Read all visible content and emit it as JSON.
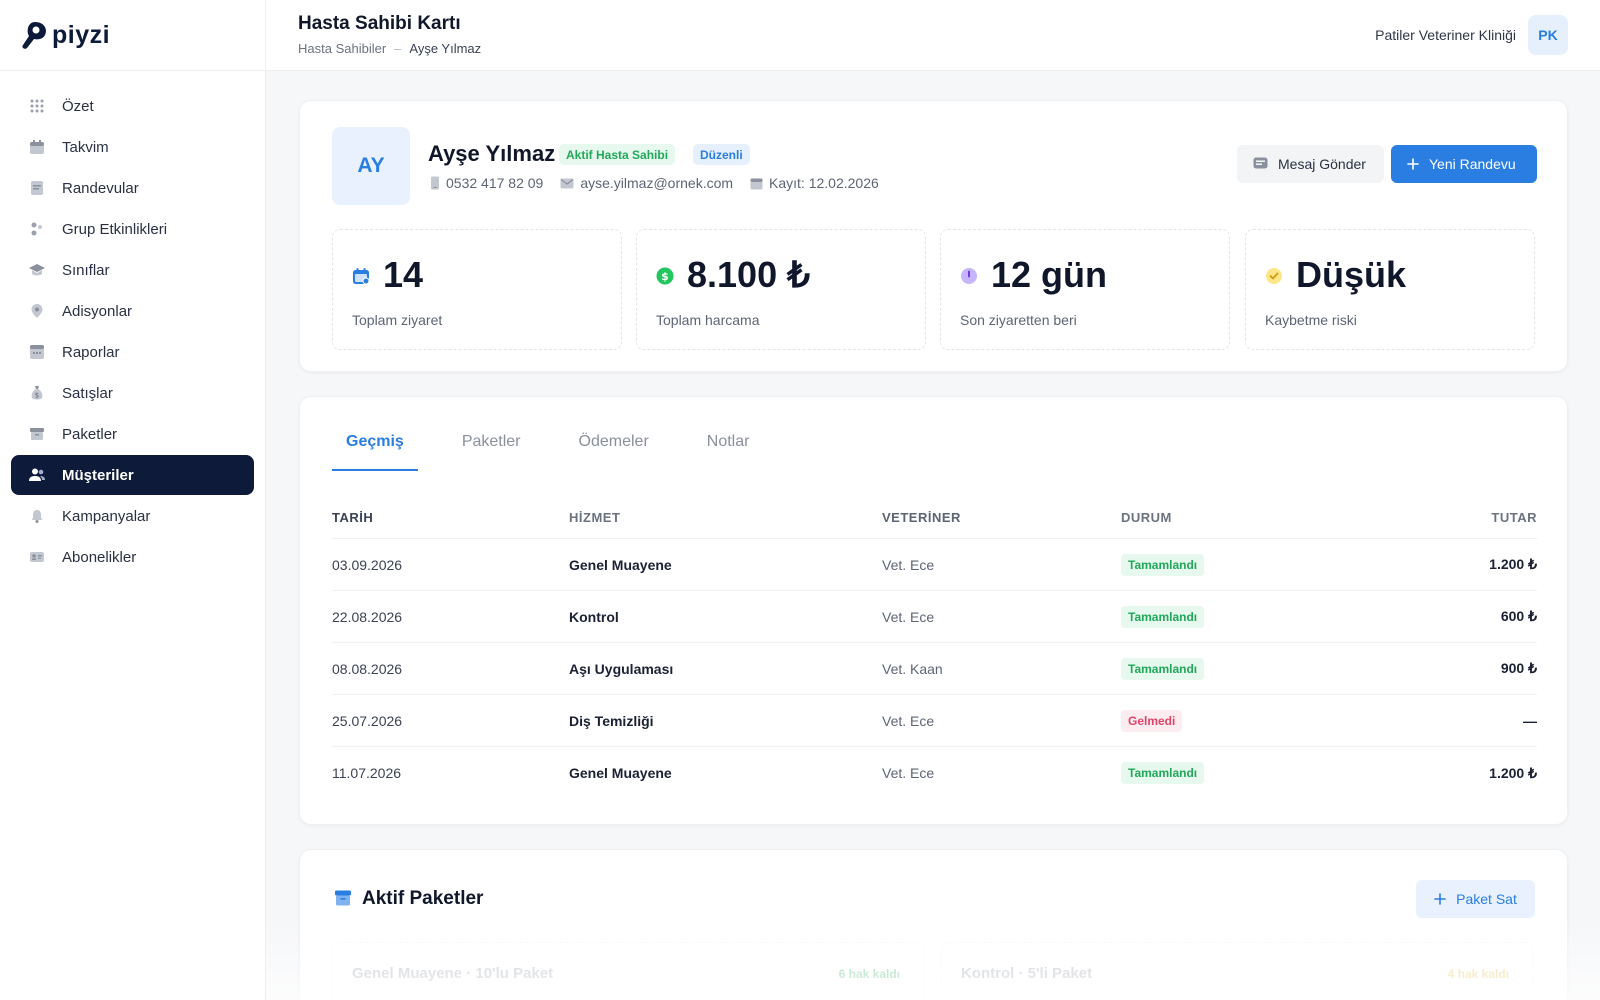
{
  "app": {
    "logo_text": "piyzi"
  },
  "sidebar": {
    "items": [
      {
        "label": "Özet",
        "icon": "grid-icon"
      },
      {
        "label": "Takvim",
        "icon": "calendar-icon"
      },
      {
        "label": "Randevular",
        "icon": "appointment-icon"
      },
      {
        "label": "Grup Etkinlikleri",
        "icon": "group-icon"
      },
      {
        "label": "Sınıflar",
        "icon": "graduation-cap-icon"
      },
      {
        "label": "Adisyonlar",
        "icon": "location-pin-icon"
      },
      {
        "label": "Raporlar",
        "icon": "report-icon"
      },
      {
        "label": "Satışlar",
        "icon": "money-bag-icon"
      },
      {
        "label": "Paketler",
        "icon": "package-icon"
      },
      {
        "label": "Müşteriler",
        "icon": "users-icon",
        "active": true
      },
      {
        "label": "Kampanyalar",
        "icon": "bell-icon"
      },
      {
        "label": "Abonelikler",
        "icon": "id-card-icon"
      }
    ]
  },
  "header": {
    "title": "Hasta Sahibi Kartı",
    "breadcrumb": [
      "Hasta Sahibiler",
      "Ayşe Yılmaz"
    ],
    "breadcrumb_sep": "–",
    "clinic_name": "Patiler Veteriner Kliniği",
    "user_initials": "PK"
  },
  "profile": {
    "initials": "AY",
    "name": "Ayşe Yılmaz",
    "badges": [
      "Aktif Hasta Sahibi",
      "Düzenli"
    ],
    "phone": "0532 417 82 09",
    "email": "ayse.yilmaz@ornek.com",
    "registered": "Kayıt: 12.02.2026",
    "message_button": "Mesaj Gönder",
    "new_appointment_button": "Yeni Randevu"
  },
  "stats": [
    {
      "value": "14",
      "label": "Toplam ziyaret",
      "icon": "calendar-icon",
      "color": "#2a7de1"
    },
    {
      "value": "8.100 ₺",
      "label": "Toplam harcama",
      "icon": "dollar-icon",
      "color": "#22a85a"
    },
    {
      "value": "12 gün",
      "label": "Son ziyaretten beri",
      "icon": "clock-icon",
      "color": "#8b5cf6"
    },
    {
      "value": "Düşük",
      "label": "Kaybetme riski",
      "icon": "shield-check-icon",
      "color": "#f5c542"
    }
  ],
  "tabs": [
    "Geçmiş",
    "Paketler",
    "Ödemeler",
    "Notlar"
  ],
  "history": {
    "columns": [
      "TARİH",
      "HİZMET",
      "VETERİNER",
      "DURUM",
      "TUTAR"
    ],
    "rows": [
      {
        "date": "03.09.2026",
        "service": "Genel Muayene",
        "vet": "Vet. Ece",
        "status": "Tamamlandı",
        "status_type": "ok",
        "amount": "1.200 ₺"
      },
      {
        "date": "22.08.2026",
        "service": "Kontrol",
        "vet": "Vet. Ece",
        "status": "Tamamlandı",
        "status_type": "ok",
        "amount": "600 ₺"
      },
      {
        "date": "08.08.2026",
        "service": "Aşı Uygulaması",
        "vet": "Vet. Kaan",
        "status": "Tamamlandı",
        "status_type": "ok",
        "amount": "900 ₺"
      },
      {
        "date": "25.07.2026",
        "service": "Diş Temizliği",
        "vet": "Vet. Ece",
        "status": "Gelmedi",
        "status_type": "no",
        "amount": "—"
      },
      {
        "date": "11.07.2026",
        "service": "Genel Muayene",
        "vet": "Vet. Ece",
        "status": "Tamamlandı",
        "status_type": "ok",
        "amount": "1.200 ₺"
      }
    ]
  },
  "packages": {
    "title": "Aktif Paketler",
    "sell_button": "Paket Sat",
    "items": [
      {
        "name": "Genel Muayene · 10'lu Paket",
        "remaining": "6 hak kaldı",
        "color": "#22a85a"
      },
      {
        "name": "Kontrol · 5'li Paket",
        "remaining": "4 hak kaldı",
        "color": "#f5c542"
      }
    ]
  },
  "colors": {
    "brand": "#0d1a3a",
    "accent": "#2a7de1",
    "success": "#22a85a",
    "danger": "#e0456b"
  }
}
